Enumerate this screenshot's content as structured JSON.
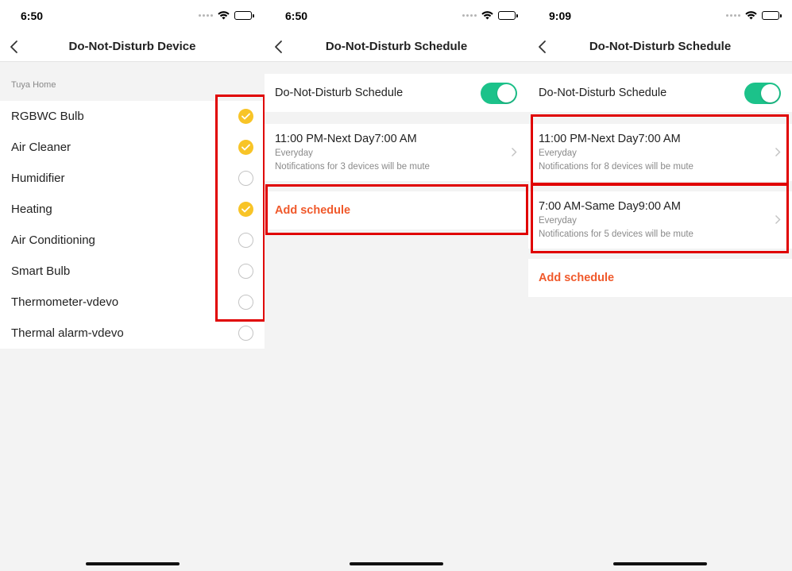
{
  "status_bars": [
    {
      "time": "6:50"
    },
    {
      "time": "6:50"
    },
    {
      "time": "9:09"
    }
  ],
  "device_screen": {
    "title": "Do-Not-Disturb Device",
    "section_label": "Tuya Home",
    "devices": [
      {
        "name": "RGBWC Bulb",
        "checked": true
      },
      {
        "name": "Air Cleaner",
        "checked": true
      },
      {
        "name": "Humidifier",
        "checked": false
      },
      {
        "name": "Heating",
        "checked": true
      },
      {
        "name": "Air Conditioning",
        "checked": false
      },
      {
        "name": "Smart Bulb",
        "checked": false
      },
      {
        "name": "Thermometer-vdevo",
        "checked": false
      },
      {
        "name": "Thermal alarm-vdevo",
        "checked": false
      }
    ]
  },
  "schedule_screen_1": {
    "title": "Do-Not-Disturb Schedule",
    "toggle_label": "Do-Not-Disturb Schedule",
    "toggle_on": true,
    "schedules": [
      {
        "time": "11:00 PM-Next Day7:00 AM",
        "repeat": "Everyday",
        "note": "Notifications for 3 devices will be mute"
      }
    ],
    "add_label": "Add schedule"
  },
  "schedule_screen_2": {
    "title": "Do-Not-Disturb Schedule",
    "toggle_label": "Do-Not-Disturb Schedule",
    "toggle_on": true,
    "schedules": [
      {
        "time": "11:00 PM-Next Day7:00 AM",
        "repeat": "Everyday",
        "note": "Notifications for 8 devices will be mute"
      },
      {
        "time": "7:00 AM-Same Day9:00 AM",
        "repeat": "Everyday",
        "note": "Notifications for 5 devices will be mute"
      }
    ],
    "add_label": "Add schedule"
  },
  "colors": {
    "accent_check": "#f8c427",
    "toggle_on": "#1cc28a",
    "add_text": "#f0592b",
    "highlight": "#e00000"
  }
}
